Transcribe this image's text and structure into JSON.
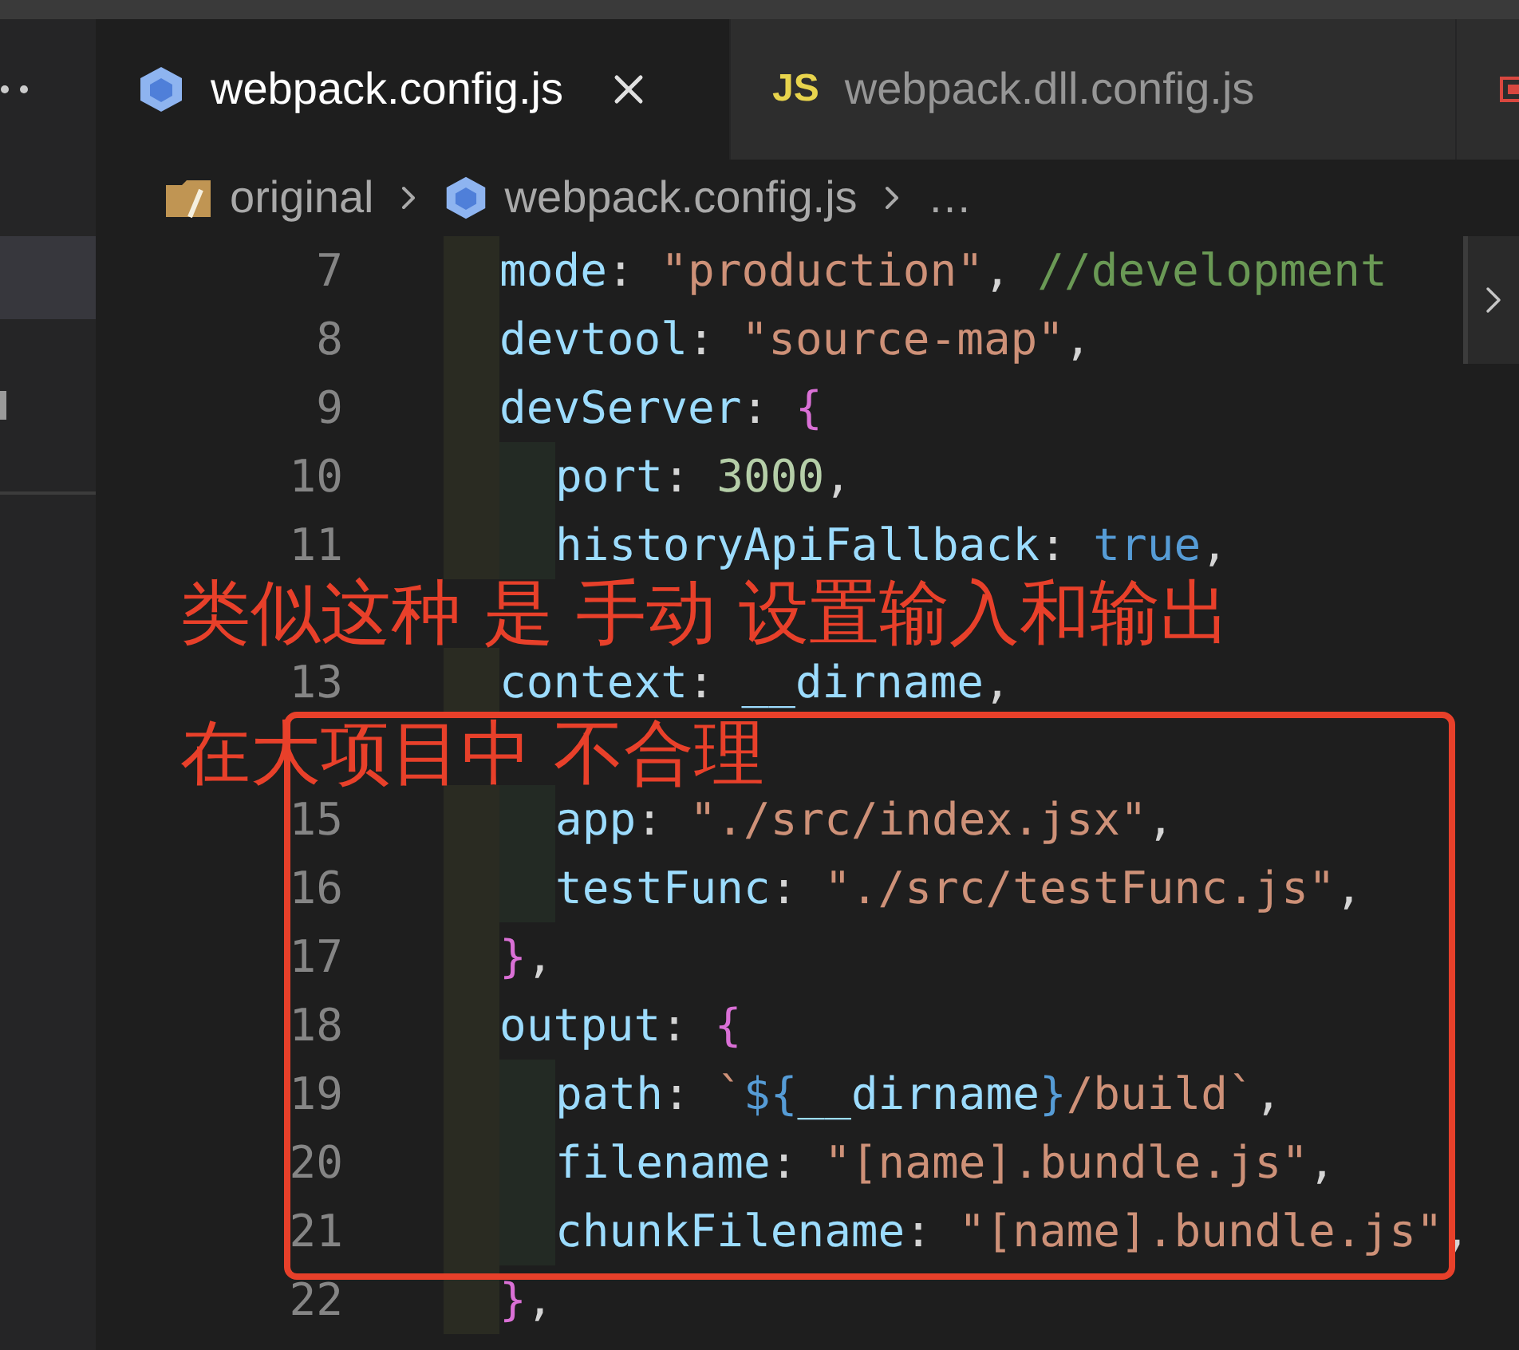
{
  "tabs": [
    {
      "kind": "webpack",
      "label": "webpack.config.js",
      "selected": true
    },
    {
      "kind": "js",
      "icon_text": "JS",
      "label": "webpack.dll.config.js",
      "selected": false
    },
    {
      "kind": "other",
      "selected": false
    }
  ],
  "breadcrumb": {
    "items": [
      {
        "kind": "folder",
        "label": "original"
      },
      {
        "kind": "webpack",
        "label": "webpack.config.js"
      }
    ],
    "more": "…"
  },
  "editor": {
    "lines": [
      {
        "number": "7",
        "kind": "top",
        "tokens": [
          {
            "kind": "key",
            "text": "mode"
          },
          {
            "kind": "punct",
            "text": ": "
          },
          {
            "kind": "string",
            "text": "\"production\""
          },
          {
            "kind": "punct",
            "text": ", "
          },
          {
            "kind": "comment",
            "text": "//development"
          }
        ]
      },
      {
        "number": "8",
        "kind": "top",
        "tokens": [
          {
            "kind": "key",
            "text": "devtool"
          },
          {
            "kind": "punct",
            "text": ": "
          },
          {
            "kind": "string",
            "text": "\"source-map\""
          },
          {
            "kind": "punct",
            "text": ","
          }
        ]
      },
      {
        "number": "9",
        "kind": "top",
        "tokens": [
          {
            "kind": "key",
            "text": "devServer"
          },
          {
            "kind": "punct",
            "text": ": "
          },
          {
            "kind": "brace",
            "text": "{"
          }
        ]
      },
      {
        "number": "10",
        "kind": "nested",
        "tokens": [
          {
            "kind": "key",
            "text": "port"
          },
          {
            "kind": "punct",
            "text": ": "
          },
          {
            "kind": "number",
            "text": "3000"
          },
          {
            "kind": "punct",
            "text": ","
          }
        ]
      },
      {
        "number": "11",
        "kind": "nested",
        "tokens": [
          {
            "kind": "key",
            "text": "historyApiFallback"
          },
          {
            "kind": "punct",
            "text": ": "
          },
          {
            "kind": "bool",
            "text": "true"
          },
          {
            "kind": "punct",
            "text": ","
          }
        ]
      },
      {
        "kind": "covered"
      },
      {
        "number": "13",
        "kind": "top",
        "tokens": [
          {
            "kind": "key",
            "text": "context"
          },
          {
            "kind": "punct",
            "text": ": "
          },
          {
            "kind": "key",
            "text": "__dirname"
          },
          {
            "kind": "punct",
            "text": ","
          }
        ]
      },
      {
        "kind": "covered"
      },
      {
        "number": "15",
        "kind": "nested",
        "tokens": [
          {
            "kind": "key",
            "text": "app"
          },
          {
            "kind": "punct",
            "text": ": "
          },
          {
            "kind": "string",
            "text": "\"./src/index.jsx\""
          },
          {
            "kind": "punct",
            "text": ","
          }
        ]
      },
      {
        "number": "16",
        "kind": "nested",
        "tokens": [
          {
            "kind": "key",
            "text": "testFunc"
          },
          {
            "kind": "punct",
            "text": ": "
          },
          {
            "kind": "string",
            "text": "\"./src/testFunc.js\""
          },
          {
            "kind": "punct",
            "text": ","
          }
        ]
      },
      {
        "number": "17",
        "kind": "top",
        "tokens": [
          {
            "kind": "brace",
            "text": "}"
          },
          {
            "kind": "punct",
            "text": ","
          }
        ]
      },
      {
        "number": "18",
        "kind": "top",
        "tokens": [
          {
            "kind": "key",
            "text": "output"
          },
          {
            "kind": "punct",
            "text": ": "
          },
          {
            "kind": "brace",
            "text": "{"
          }
        ]
      },
      {
        "number": "19",
        "kind": "nested",
        "tokens": [
          {
            "kind": "key",
            "text": "path"
          },
          {
            "kind": "punct",
            "text": ": "
          },
          {
            "kind": "string",
            "text": "`"
          },
          {
            "kind": "bool",
            "text": "${"
          },
          {
            "kind": "key",
            "text": "__dirname"
          },
          {
            "kind": "bool",
            "text": "}"
          },
          {
            "kind": "string",
            "text": "/build`"
          },
          {
            "kind": "punct",
            "text": ","
          }
        ]
      },
      {
        "number": "20",
        "kind": "nested",
        "tokens": [
          {
            "kind": "key",
            "text": "filename"
          },
          {
            "kind": "punct",
            "text": ": "
          },
          {
            "kind": "string",
            "text": "\"[name].bundle.js\""
          },
          {
            "kind": "punct",
            "text": ","
          }
        ]
      },
      {
        "number": "21",
        "kind": "nested",
        "tokens": [
          {
            "kind": "key",
            "text": "chunkFilename"
          },
          {
            "kind": "punct",
            "text": ": "
          },
          {
            "kind": "string",
            "text": "\"[name].bundle.js\""
          },
          {
            "kind": "punct",
            "text": ","
          }
        ]
      },
      {
        "number": "22",
        "kind": "top",
        "tokens": [
          {
            "kind": "brace",
            "text": "}"
          },
          {
            "kind": "punct",
            "text": ","
          }
        ]
      }
    ]
  },
  "annotations": {
    "notes": [
      "类似这种 是 手动 设置输入和输出",
      "在大项目中 不合理"
    ]
  }
}
